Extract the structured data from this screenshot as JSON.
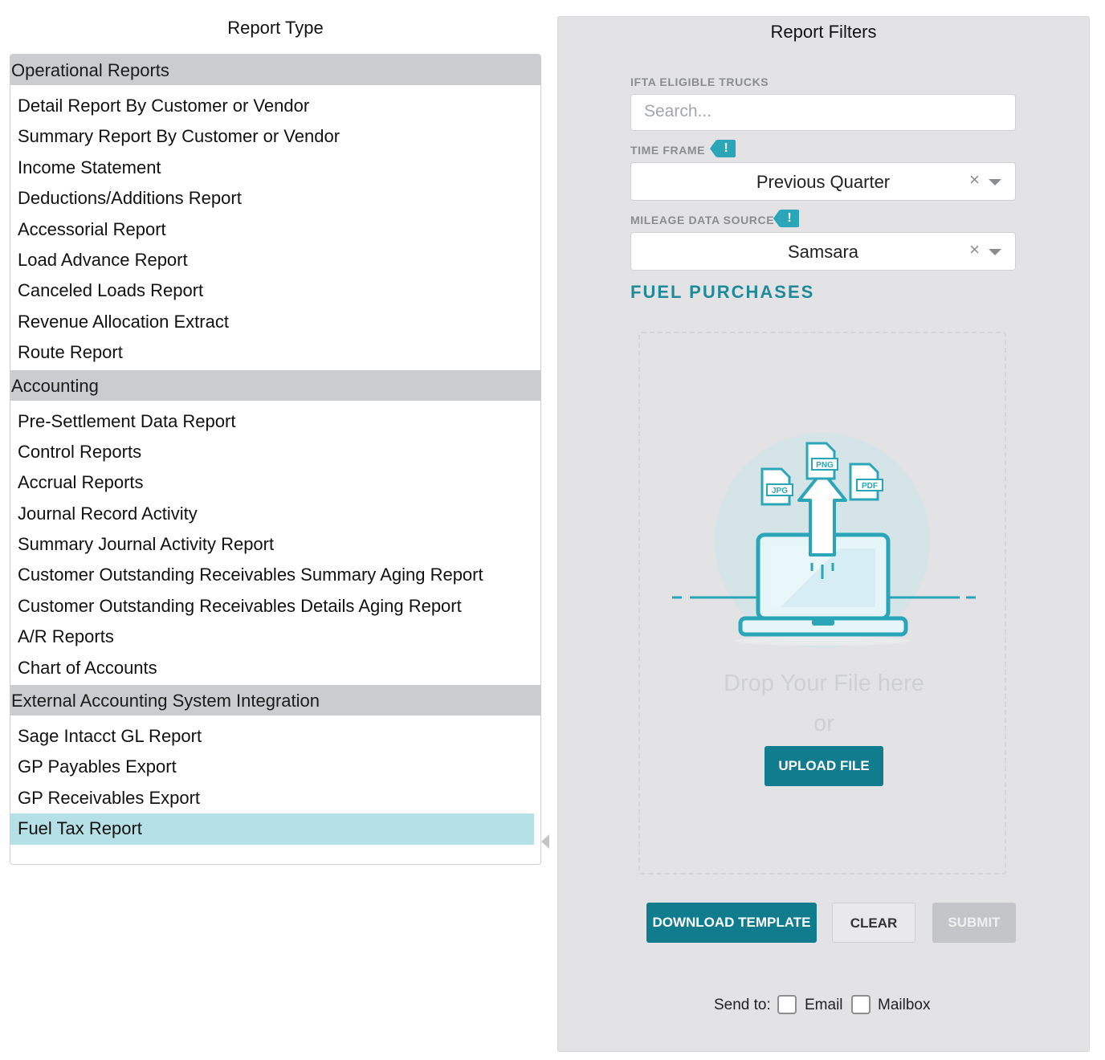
{
  "left": {
    "title": "Report Type",
    "groups": [
      {
        "header": "Operational Reports",
        "items": [
          "Detail Report By Customer or Vendor",
          "Summary Report By Customer or Vendor",
          "Income Statement",
          "Deductions/Additions Report",
          "Accessorial Report",
          "Load Advance Report",
          "Canceled Loads Report",
          "Revenue Allocation Extract",
          "Route Report"
        ]
      },
      {
        "header": "Accounting",
        "items": [
          "Pre-Settlement Data Report",
          "Control Reports",
          "Accrual Reports",
          "Journal Record Activity",
          "Summary Journal Activity Report",
          "Customer Outstanding Receivables Summary Aging Report",
          "Customer Outstanding Receivables Details Aging Report",
          "A/R Reports",
          "Chart of Accounts"
        ]
      },
      {
        "header": "External Accounting System Integration",
        "items": [
          "Sage Intacct GL Report",
          "GP Payables Export",
          "GP Receivables Export",
          "Fuel Tax Report"
        ]
      }
    ],
    "selected_item": "Fuel Tax Report"
  },
  "right": {
    "title": "Report Filters",
    "trucks": {
      "label": "IFTA ELIGIBLE TRUCKS",
      "placeholder": "Search..."
    },
    "time_frame": {
      "label": "TIME FRAME",
      "badge": "!",
      "value": "Previous Quarter",
      "clear": "×"
    },
    "mileage": {
      "label": "MILEAGE DATA SOURCE",
      "badge": "!",
      "value": "Samsara",
      "clear": "×"
    },
    "fuel_title": "FUEL PURCHASES",
    "upload": {
      "file_types": [
        "JPG",
        "PNG",
        "PDF"
      ],
      "drop_text": "Drop Your File here",
      "or_text": "or",
      "button": "UPLOAD FILE"
    },
    "buttons": {
      "download": "DOWNLOAD TEMPLATE",
      "clear": "CLEAR",
      "submit": "SUBMIT"
    },
    "send_to": {
      "label": "Send to:",
      "email": "Email",
      "mailbox": "Mailbox",
      "email_checked": false,
      "mailbox_checked": false
    }
  },
  "colors": {
    "accent": "#117c8d",
    "teal_light": "#2aa6b8",
    "selected_bg": "#b5e0e5",
    "group_bg": "#cbcccf",
    "panel_bg": "#e3e3e5"
  }
}
